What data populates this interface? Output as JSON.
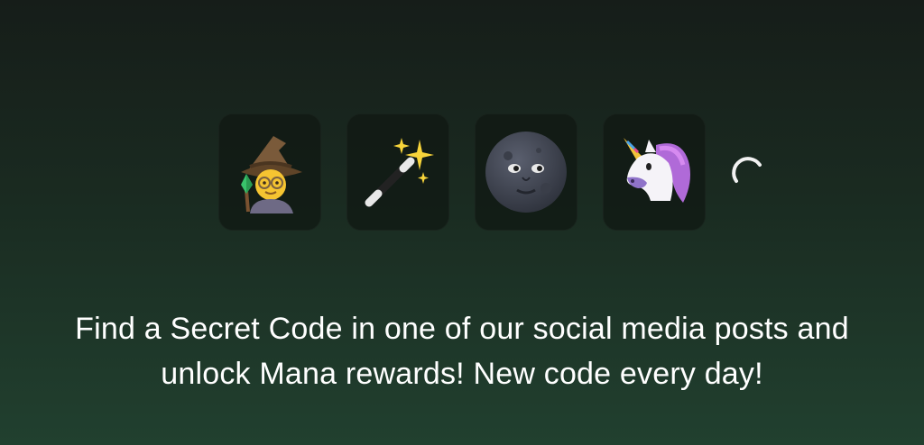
{
  "tiles": [
    {
      "icon": "mage-icon"
    },
    {
      "icon": "magic-wand-icon"
    },
    {
      "icon": "new-moon-face-icon"
    },
    {
      "icon": "unicorn-icon"
    }
  ],
  "loading_icon": "loading-spinner-icon",
  "message": "Find a Secret Code in one of our social media posts and unlock Mana rewards! New code every day!",
  "colors": {
    "background_top": "#161d19",
    "background_bottom": "#21402f",
    "tile": "#111813",
    "text": "#ffffff"
  }
}
